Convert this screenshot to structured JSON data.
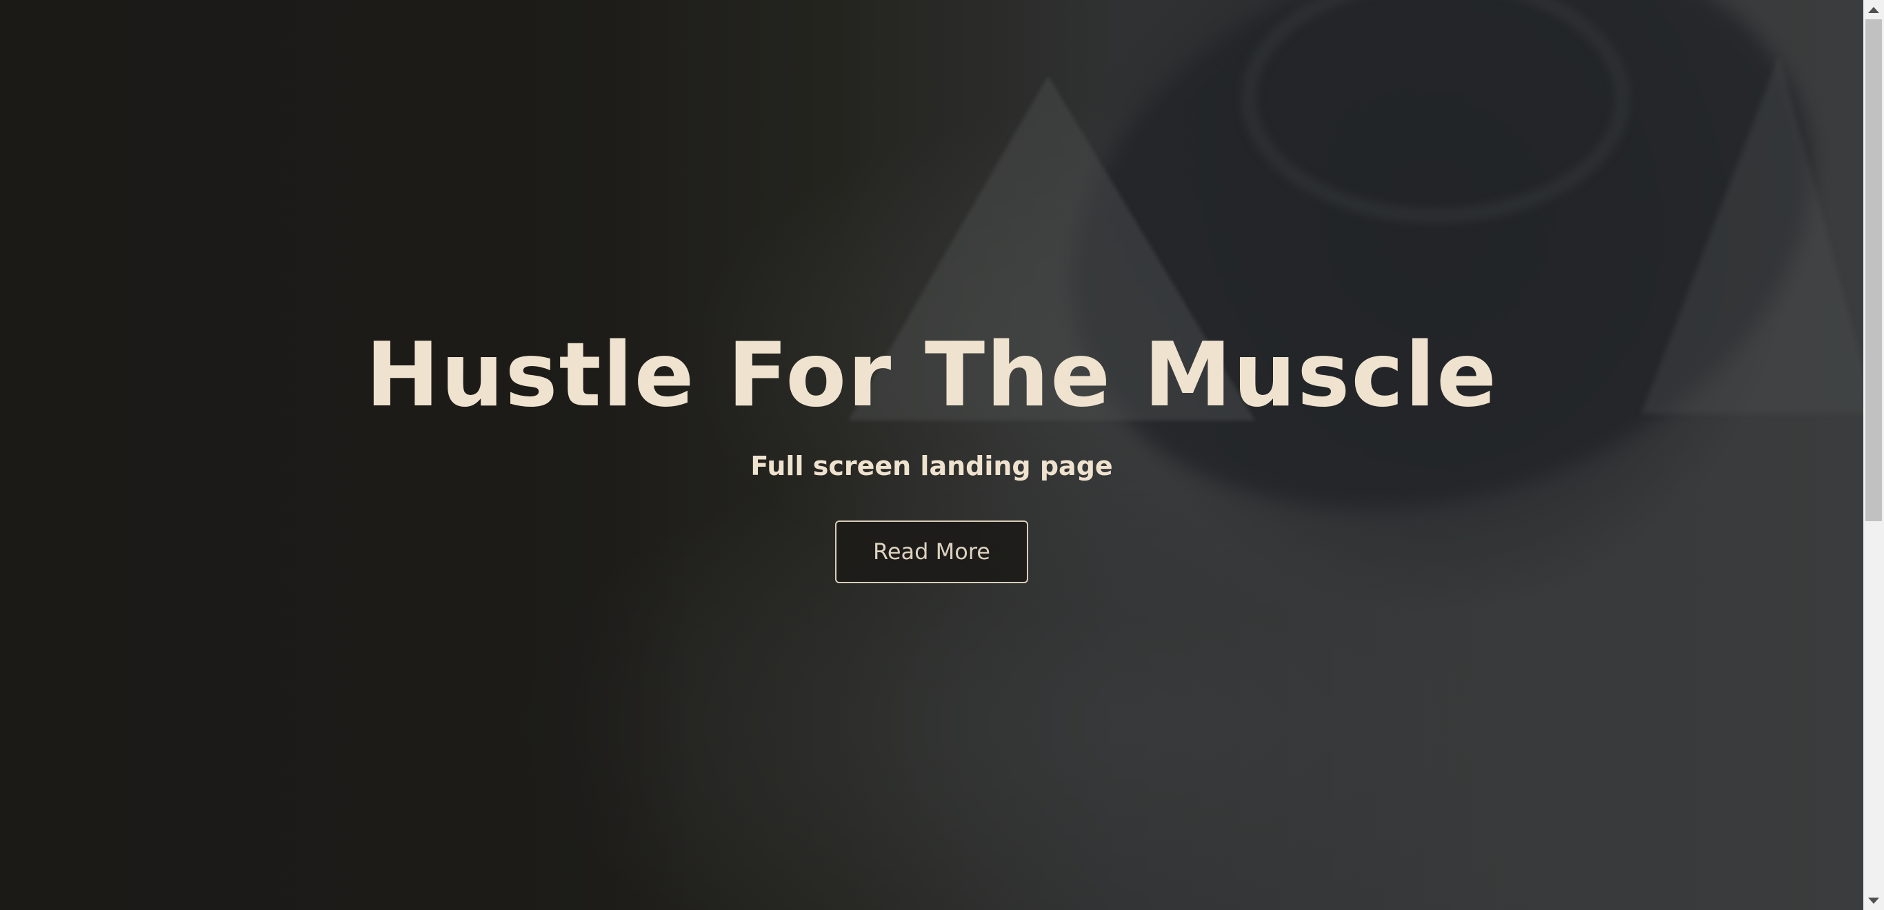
{
  "hero": {
    "title": "Hustle For The Muscle",
    "subtitle": "Full screen landing page",
    "cta_label": "Read More"
  },
  "scrollbar": {
    "up_icon": "triangle-up-icon",
    "down_icon": "triangle-down-icon"
  },
  "colors": {
    "text": "#efe3cf",
    "background": "#1c1b18",
    "button_border": "#d9cdb8"
  }
}
